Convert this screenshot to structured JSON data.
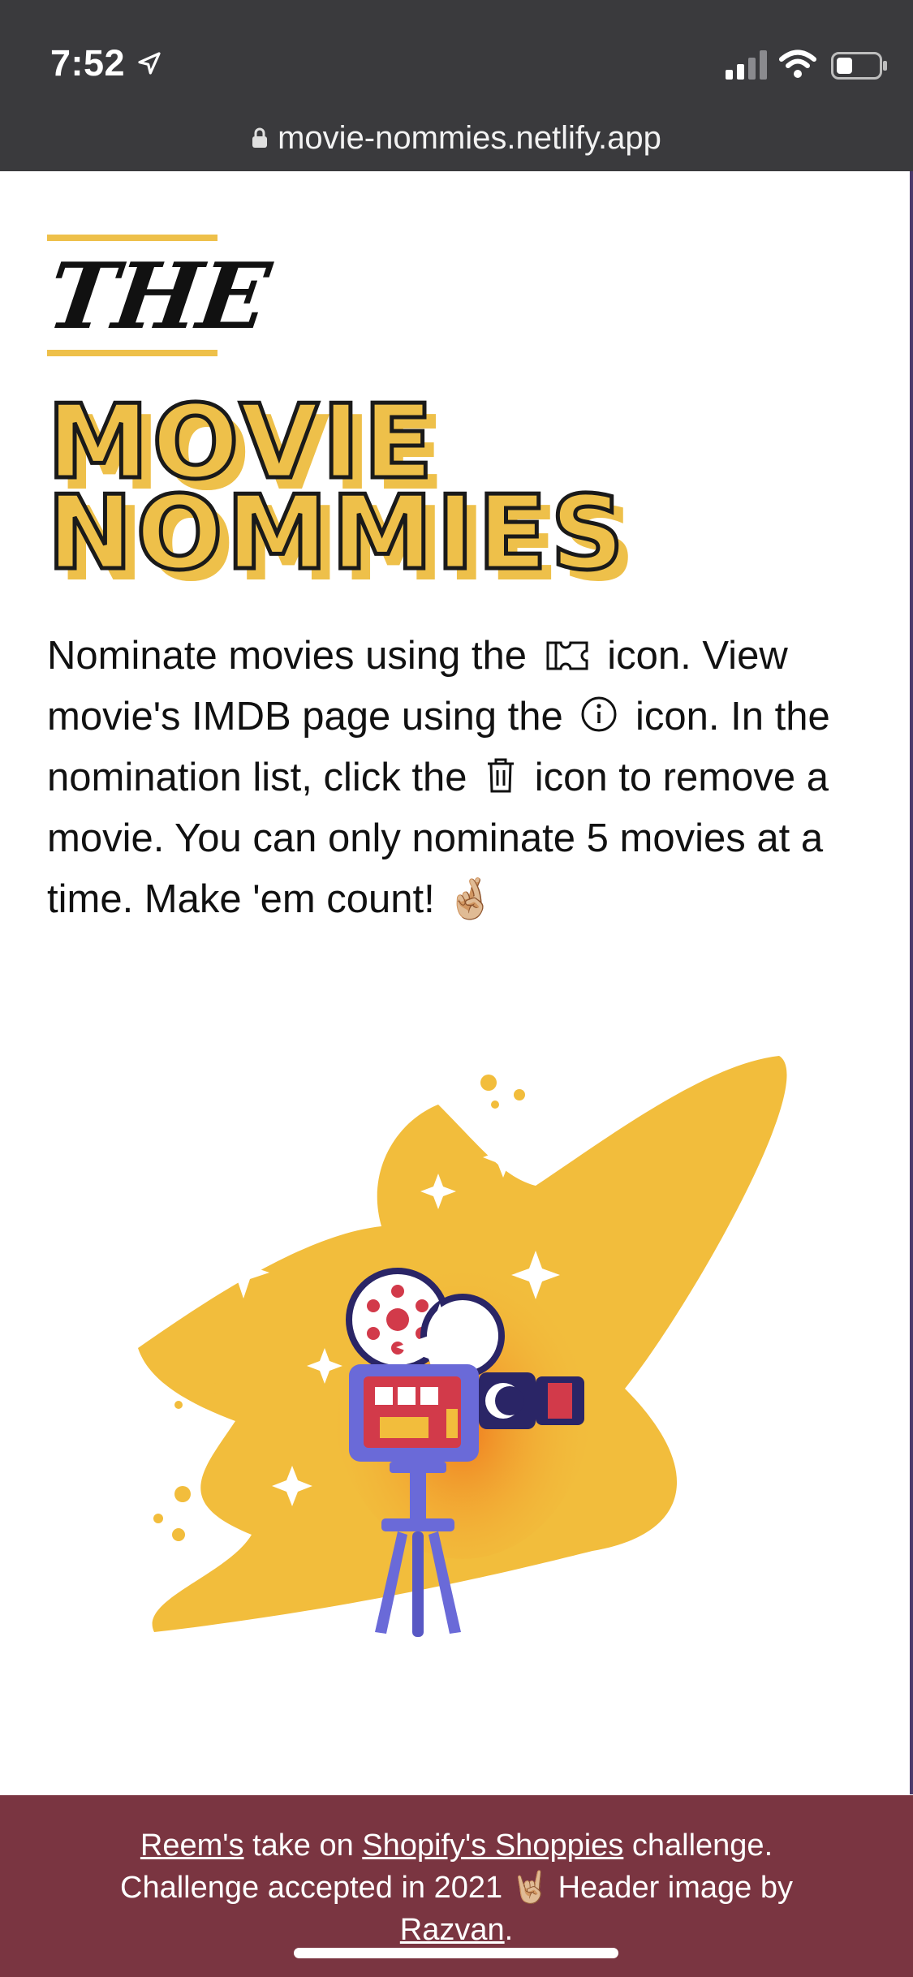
{
  "status_bar": {
    "time": "7:52"
  },
  "browser": {
    "url": "movie-nommies.netlify.app"
  },
  "header": {
    "the": "THE",
    "title_line1": "MOVIE",
    "title_line2": "NOMMIES"
  },
  "intro": {
    "part1": "Nominate movies using the",
    "part2": "icon. View movie's IMDB page using the",
    "part3": "icon. In the nomination list, click the",
    "part4": "icon to remove a movie. You can only nominate 5 movies at a time. Make 'em count!",
    "emoji": "🤞🏼"
  },
  "footer": {
    "author_link": "Reem's",
    "text1": "take on",
    "challenge_link": "Shopify's Shoppies",
    "text2": "challenge.",
    "text3": "Challenge accepted in 2021",
    "emoji": "🤘🏼",
    "text4": "Header image by",
    "credit_link": "Razvan",
    "text5": "."
  },
  "colors": {
    "accent": "#eec04a",
    "footer_bg": "#7a3541",
    "status_bg": "#3a3a3d"
  }
}
